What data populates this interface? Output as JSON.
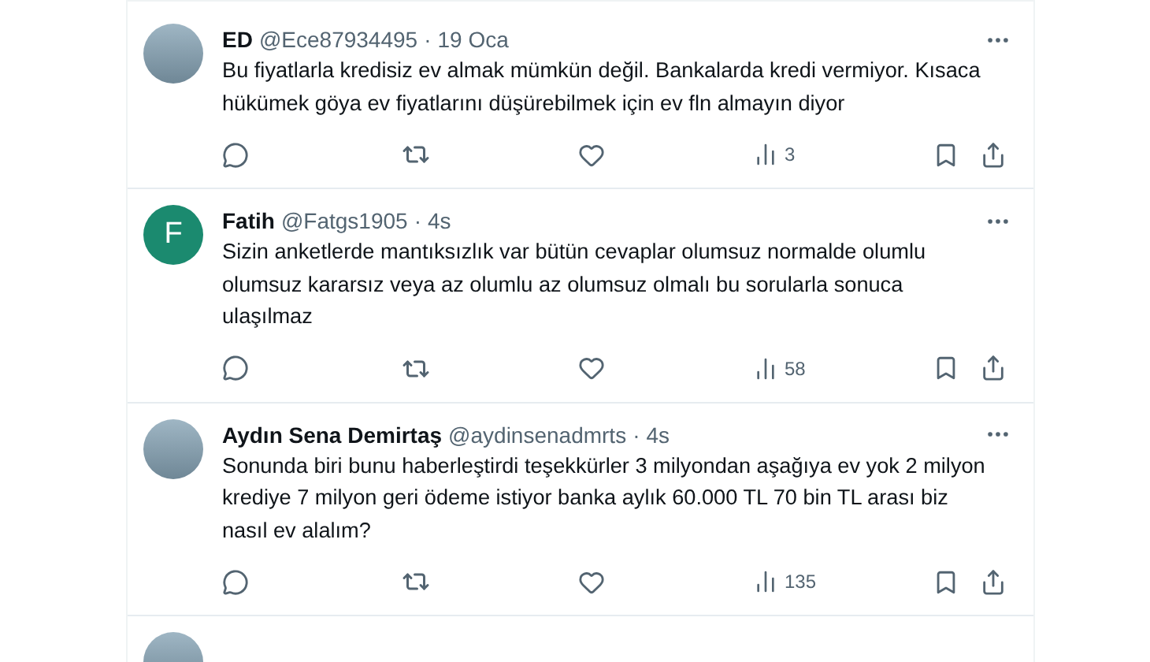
{
  "tweets": [
    {
      "avatar": {
        "kind": "photo"
      },
      "name": "ED",
      "handle": "@Ece87934495",
      "separator": "·",
      "time": "19 Oca",
      "text": "Bu fiyatlarla kredisiz ev almak mümkün değil. Bankalarda kredi vermiyor. Kısaca hükümek göya ev fiyatlarını düşürebilmek için ev fln almayın diyor",
      "views": "3"
    },
    {
      "avatar": {
        "kind": "letter",
        "letter": "F",
        "color": "#1b8a6f"
      },
      "name": "Fatih",
      "handle": "@Fatgs1905",
      "separator": "·",
      "time": "4s",
      "text": "Sizin anketlerde mantıksızlık var bütün cevaplar olumsuz normalde olumlu olumsuz kararsız veya az olumlu az olumsuz olmalı bu sorularla sonuca ulaşılmaz",
      "views": "58"
    },
    {
      "avatar": {
        "kind": "photo"
      },
      "name": "Aydın Sena Demirtaş",
      "handle": "@aydinsenadmrts",
      "separator": "·",
      "time": "4s",
      "text": "Sonunda biri bunu haberleştirdi teşekkürler 3 milyondan aşağıya ev yok 2 milyon krediye 7 milyon geri ödeme istiyor banka aylık 60.000 TL 70 bin TL arası biz nasıl ev alalım?",
      "views": "135"
    }
  ],
  "partial_tweet": {
    "avatar": {
      "kind": "photo"
    }
  }
}
